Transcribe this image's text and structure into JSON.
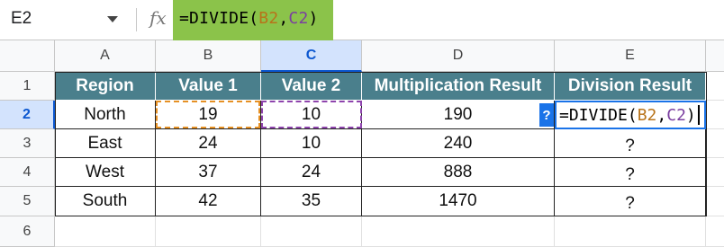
{
  "formula_bar": {
    "name_box": "E2",
    "fx_label": "fx",
    "formula_prefix": "=DIVIDE(",
    "formula_ref1": "B2",
    "formula_sep": ",",
    "formula_ref2": "C2",
    "formula_suffix": ")"
  },
  "sheet": {
    "columns": [
      "A",
      "B",
      "C",
      "D",
      "E"
    ],
    "rows": [
      "1",
      "2",
      "3",
      "4",
      "5",
      "6"
    ],
    "selected_column": "C",
    "selected_row": "2",
    "headers": [
      "Region",
      "Value 1",
      "Value 2",
      "Multiplication Result",
      "Division Result"
    ],
    "data": [
      [
        "North",
        "19",
        "10",
        "190",
        ""
      ],
      [
        "East",
        "24",
        "10",
        "240",
        "?"
      ],
      [
        "West",
        "37",
        "24",
        "888",
        "?"
      ],
      [
        "South",
        "42",
        "35",
        "1470",
        "?"
      ]
    ],
    "edit_cell": {
      "prefix": "=DIVIDE(",
      "ref1": "B2",
      "sep": ",",
      "ref2": "C2",
      "suffix": ")"
    },
    "help_badge": "?"
  },
  "colors": {
    "header_fill": "#4a7f8c",
    "formula_highlight": "#8bc34a",
    "ref_b": "#b8731a",
    "ref_c": "#7b3fa0",
    "selection_blue": "#1a73e8"
  }
}
